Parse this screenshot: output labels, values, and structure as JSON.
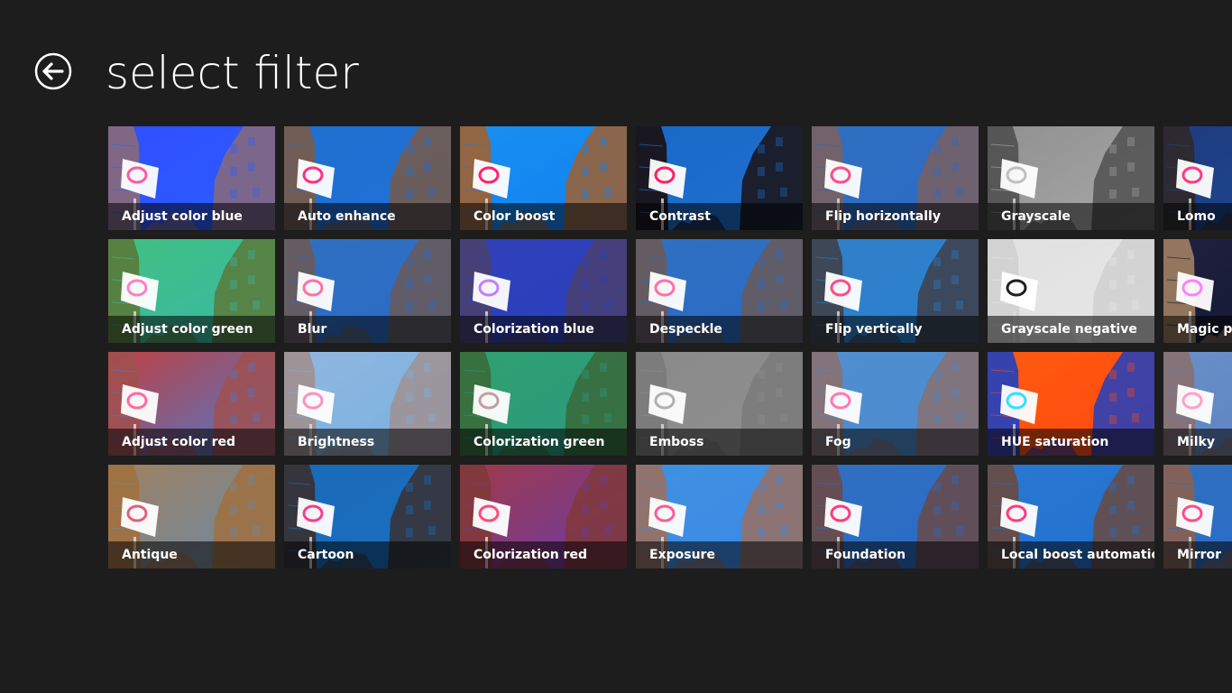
{
  "header": {
    "title": "select filter",
    "back_icon": "back-arrow-icon"
  },
  "filters": [
    {
      "label": "Adjust color blue",
      "sky": "#2a5cff",
      "bld": "#8a6a78",
      "tint": "#3050ff",
      "sign": "#ff5aa0"
    },
    {
      "label": "Adjust color green",
      "sky": "#3ab8a8",
      "bld": "#5a7a3a",
      "tint": "#40c080",
      "sign": "#ff80c0"
    },
    {
      "label": "Adjust color red",
      "sky": "#4a7ad0",
      "bld": "#a05050",
      "tint": "#c04040",
      "sign": "#ff6aa0"
    },
    {
      "label": "Antique",
      "sky": "#6a8aa8",
      "bld": "#a07040",
      "tint": "#a08060",
      "sign": "#e06080"
    },
    {
      "label": "Auto enhance",
      "sky": "#1f6fd8",
      "bld": "#7a5a48",
      "tint": "#2070d0",
      "sign": "#ff3080"
    },
    {
      "label": "Blur",
      "sky": "#2a6ac8",
      "bld": "#6a5a58",
      "tint": "#3070c0",
      "sign": "#ff70a8"
    },
    {
      "label": "Brightness",
      "sky": "#7ab0e0",
      "bld": "#a09090",
      "tint": "#90b8e0",
      "sign": "#ff90c0"
    },
    {
      "label": "Cartoon",
      "sky": "#1a70c0",
      "bld": "#3a3030",
      "tint": "#1a6ab8",
      "sign": "#ff3a8a"
    },
    {
      "label": "Color boost",
      "sky": "#1080f0",
      "bld": "#a06030",
      "tint": "#1890f0",
      "sign": "#ff2070"
    },
    {
      "label": "Colorization blue",
      "sky": "#2a40c0",
      "bld": "#4a4070",
      "tint": "#3040b8",
      "sign": "#c080ff"
    },
    {
      "label": "Colorization green",
      "sky": "#2a9a80",
      "bld": "#3a6a3a",
      "tint": "#30a070",
      "sign": "#c0a0a0"
    },
    {
      "label": "Colorization red",
      "sky": "#6a3aa8",
      "bld": "#803a3a",
      "tint": "#a03a4a",
      "sign": "#ff4a7a"
    },
    {
      "label": "Contrast",
      "sky": "#2070d0",
      "bld": "#1a1010",
      "tint": "#1868c8",
      "sign": "#ff2060"
    },
    {
      "label": "Despeckle",
      "sky": "#2a6ac8",
      "bld": "#6a5a58",
      "tint": "#3070c0",
      "sign": "#ff70a8"
    },
    {
      "label": "Emboss",
      "sky": "#909090",
      "bld": "#7a7a7a",
      "tint": "#8a8a8a",
      "sign": "#b0b0b0"
    },
    {
      "label": "Exposure",
      "sky": "#3a8ae8",
      "bld": "#9a7060",
      "tint": "#4090e0",
      "sign": "#ff5a9a"
    },
    {
      "label": "Flip horizontally",
      "sky": "#2a6ac8",
      "bld": "#7a6060",
      "tint": "#3070c0",
      "sign": "#ff4a8a"
    },
    {
      "label": "Flip vertically",
      "sky": "#2a80d0",
      "bld": "#404048",
      "tint": "#3080c8",
      "sign": "#ff4a8a"
    },
    {
      "label": "Fog",
      "sky": "#4a8ad0",
      "bld": "#8a7070",
      "tint": "#5090d0",
      "sign": "#ff7ab0"
    },
    {
      "label": "Foundation",
      "sky": "#2a6ac8",
      "bld": "#6a4a48",
      "tint": "#3070c0",
      "sign": "#ff3a80"
    },
    {
      "label": "Grayscale",
      "sky": "#a8a8a8",
      "bld": "#505050",
      "tint": "#909090",
      "sign": "#c0c0c0"
    },
    {
      "label": "Grayscale negative",
      "sky": "#e8e8e8",
      "bld": "#d0d0d0",
      "tint": "#e0e0e0",
      "sign": "#202020"
    },
    {
      "label": "HUE saturation",
      "sky": "#ff4a10",
      "bld": "#2040c0",
      "tint": "#ff5a10",
      "sign": "#30e0ff"
    },
    {
      "label": "Local boost automatic",
      "sky": "#2070d0",
      "bld": "#6a4a40",
      "tint": "#2a78d0",
      "sign": "#ff3a80"
    },
    {
      "label": "Lomo",
      "sky": "#1a4a90",
      "bld": "#302828",
      "tint": "#203a80",
      "sign": "#ff3a80"
    },
    {
      "label": "Magic pen",
      "sky": "#101830",
      "bld": "#a08060",
      "tint": "#202040",
      "sign": "#ff80ff"
    },
    {
      "label": "Milky",
      "sky": "#5a80c0",
      "bld": "#8a7070",
      "tint": "#6a90c8",
      "sign": "#ffa0c8"
    },
    {
      "label": "Mirror",
      "sky": "#2a6ac8",
      "bld": "#8a6050",
      "tint": "#3070c0",
      "sign": "#ff4a8a"
    }
  ]
}
